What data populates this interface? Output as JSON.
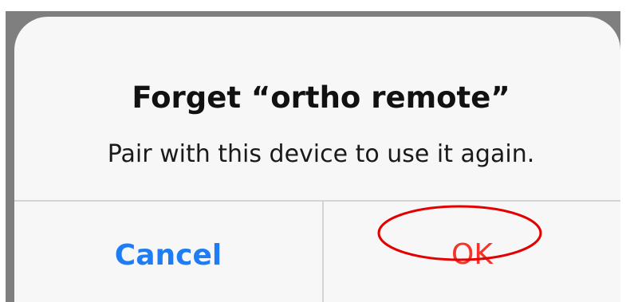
{
  "alert": {
    "title": "Forget “ortho remote”",
    "message": "Pair with this device to use it again.",
    "buttons": {
      "cancel_label": "Cancel",
      "ok_label": "OK"
    }
  },
  "colors": {
    "cancel_text": "#1e7cf4",
    "ok_text": "#f5332b",
    "highlight_ring": "#e30000",
    "alert_background": "#f7f7f7",
    "backdrop": "#7f7f7f"
  },
  "icons": {
    "highlight": "red-ellipse-annotation"
  }
}
